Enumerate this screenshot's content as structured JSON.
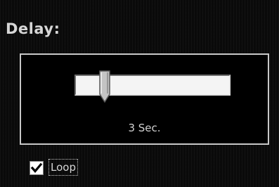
{
  "delay": {
    "title": "Delay:",
    "slider": {
      "level_fraction": 0.17
    },
    "value_label": "3 Sec."
  },
  "loop": {
    "label": "Loop",
    "checked": true
  },
  "colors": {
    "background": "#0a0a0a",
    "text": "#d6d6d6",
    "panel_border": "#c8c8c8",
    "track": "#f4f4f4",
    "thumb": "#bfbfbf"
  },
  "icons": {
    "checkbox_mark": "check-mark-icon"
  }
}
